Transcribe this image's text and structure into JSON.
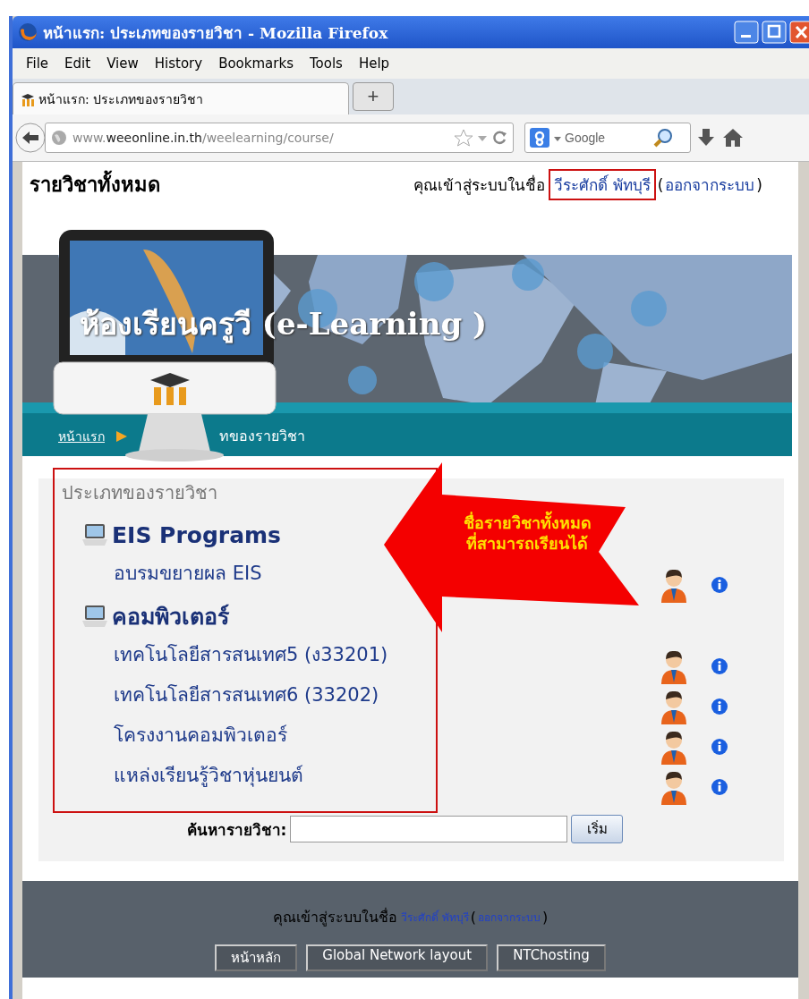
{
  "window": {
    "title": "หน้าแรก: ประเภทของรายวิชา - Mozilla Firefox"
  },
  "menu": [
    {
      "label": "File"
    },
    {
      "label": "Edit"
    },
    {
      "label": "View"
    },
    {
      "label": "History"
    },
    {
      "label": "Bookmarks"
    },
    {
      "label": "Tools"
    },
    {
      "label": "Help"
    }
  ],
  "tabs": [
    {
      "label": "หน้าแรก: ประเภทของรายวิชา",
      "selected": true
    }
  ],
  "new_tab": "+",
  "address": {
    "prefix": "www.",
    "domain": "weeonline.in.th",
    "path": "/weelearning/course/"
  },
  "search": {
    "placeholder": "Google"
  },
  "page": {
    "heading": "รายวิชาทั้งหมด",
    "login_text": "คุณเข้าสู่ระบบในชื่อ",
    "user": "วีระศักดิ์ พัทบุรี",
    "open_paren": "(",
    "logout": "ออกจากระบบ",
    "close_paren": ")"
  },
  "banner": {
    "title": "ห้องเรียนครูวี (e-Learning )",
    "breadcrumb": [
      {
        "label": "หน้าแรก",
        "link": true
      },
      {
        "label": "ทของรายวิชา",
        "link": false
      }
    ]
  },
  "categories_box": {
    "title": "ประเภทของรายวิชา",
    "categories": [
      {
        "name": "EIS Programs",
        "courses": [
          {
            "name": "อบรมขยายผล EIS"
          }
        ]
      },
      {
        "name": "คอมพิวเตอร์",
        "courses": [
          {
            "name": "เทคโนโลยีสารสนเทศ5 (ง33201)"
          },
          {
            "name": "เทคโนโลยีสารสนเทศ6 (33202)"
          },
          {
            "name": "โครงงานคอมพิวเตอร์"
          },
          {
            "name": "แหล่งเรียนรู้วิชาหุ่นยนต์"
          }
        ]
      }
    ]
  },
  "callout": {
    "lines": [
      "ชื่อรายวิชาทั้งหมด",
      "ที่สามารถเรียนได้"
    ]
  },
  "course_search": {
    "label": "ค้นหารายวิชา:",
    "button": "เริ่ม"
  },
  "footer": {
    "login_text": "คุณเข้าสู่ระบบในชื่อ",
    "user": "วีระศักดิ์ พัทบุรี",
    "open_paren": "(",
    "logout": "ออกจากระบบ",
    "close_paren": ")",
    "links": [
      {
        "label": "หน้าหลัก"
      },
      {
        "label": "Global Network layout"
      },
      {
        "label": "NTChosting"
      }
    ]
  }
}
